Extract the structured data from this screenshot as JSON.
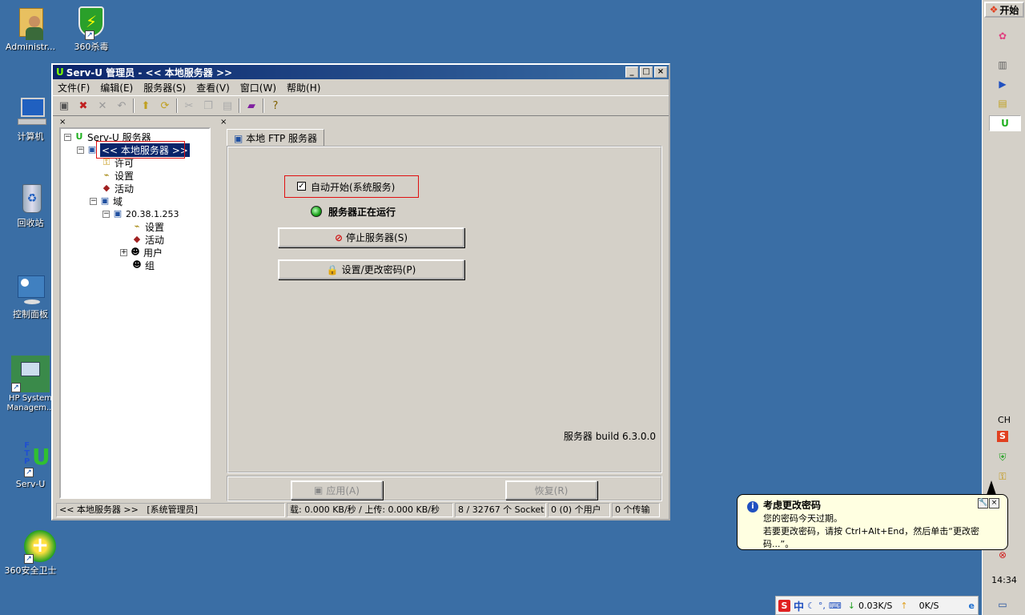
{
  "desktop": {
    "icons": [
      {
        "label": "Administr..."
      },
      {
        "label": "360杀毒"
      },
      {
        "label": "计算机"
      },
      {
        "label": "回收站"
      },
      {
        "label": "控制面板"
      },
      {
        "label": "HP System\nManagem..."
      },
      {
        "label": "Serv-U"
      },
      {
        "label": "360安全卫士"
      }
    ]
  },
  "window": {
    "title": "Serv-U 管理员 - << 本地服务器 >>",
    "controls": {
      "minimize": "_",
      "maximize": "□",
      "close": "×"
    },
    "menu": [
      "文件(F)",
      "编辑(E)",
      "服务器(S)",
      "查看(V)",
      "窗口(W)",
      "帮助(H)"
    ],
    "tree": {
      "root": "Serv-U 服务器",
      "local_server": "<< 本地服务器 >>",
      "license": "许可",
      "settings": "设置",
      "activity": "活动",
      "domains": "域",
      "domain_ip": "20.38.1.253",
      "domain_settings": "设置",
      "domain_activity": "活动",
      "users": "用户",
      "groups": "组"
    },
    "tab": "本地 FTP 服务器",
    "auto_start_label": "自动开始(系统服务)",
    "auto_start_checked": true,
    "status_text": "服务器正在运行",
    "stop_button": "停止服务器(S)",
    "password_button": "设置/更改密码(P)",
    "build_text": "服务器 build 6.3.0.0",
    "apply_button": "应用(A)",
    "restore_button": "恢复(R)",
    "statusbar": {
      "server": "<< 本地服务器 >>",
      "role": "[系统管理员]",
      "transfer": "载: 0.000 KB/秒 / 上传: 0.000 KB/秒",
      "sockets": "8 / 32767 个 Socket",
      "users": "0 (0) 个用户",
      "transfers": "0 个传输"
    }
  },
  "taskbar": {
    "start_label": "开始",
    "ime": "CH",
    "clock": "14:34"
  },
  "balloon": {
    "title": "考虑更改密码",
    "line1": "您的密码今天过期。",
    "line2": "若要更改密码，请按 Ctrl+Alt+End，然后单击“更改密码...”。"
  },
  "imebar": {
    "lang": "中",
    "down_speed": "0.03K/S",
    "up_speed": "0K/S"
  }
}
